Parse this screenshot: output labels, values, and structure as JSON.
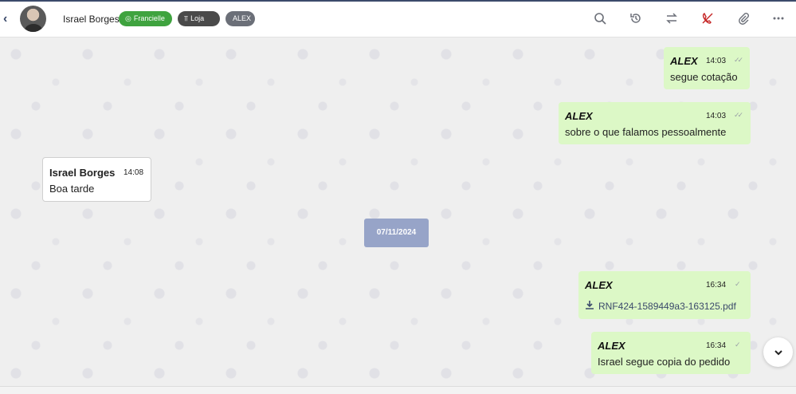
{
  "header": {
    "back_icon": "chevron-left-icon",
    "contact_name": "Israel Borges",
    "tags": [
      {
        "label": "Francielle",
        "icon": "whatsapp-icon",
        "color": "#3fa33f"
      },
      {
        "label": "Loja",
        "icon": "sitemap-icon",
        "color": "#4a4a4a"
      },
      {
        "label": "ALEX",
        "color": "#6b6f78"
      }
    ],
    "actions": [
      "search-icon",
      "history-icon",
      "transfer-icon",
      "end-call-icon",
      "attach-icon",
      "more-icon"
    ]
  },
  "messages": [
    {
      "direction": "out",
      "sender": "ALEX",
      "time": "14:03",
      "text": "segue cotação",
      "status": "read"
    },
    {
      "direction": "out",
      "sender": "ALEX",
      "time": "14:03",
      "text": "sobre o que falamos pessoalmente",
      "status": "read"
    },
    {
      "direction": "in",
      "sender": "Israel Borges",
      "time": "14:08",
      "text": "Boa tarde"
    },
    {
      "direction": "out",
      "sender": "ALEX",
      "time": "16:34",
      "file": "RNF424-1589449a3-163125.pdf",
      "status": "sent"
    },
    {
      "direction": "out",
      "sender": "ALEX",
      "time": "16:34",
      "text": "Israel segue copia do pedido",
      "status": "sent"
    }
  ],
  "date_divider": "07/11/2024",
  "colors": {
    "outgoing": "#dcf8c6",
    "incoming": "#ffffff",
    "accent": "#3b4a6b",
    "date_chip": "#97a4c8"
  }
}
